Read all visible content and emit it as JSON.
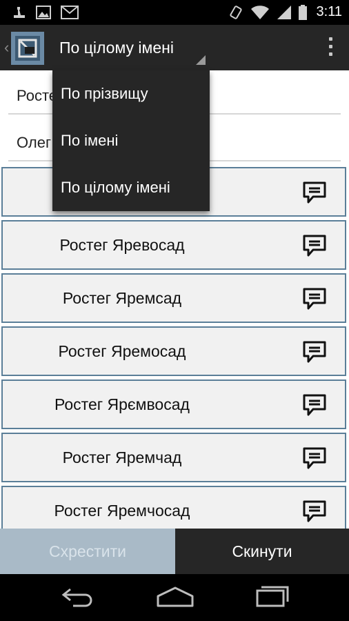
{
  "status_bar": {
    "time": "3:11",
    "left_icons": [
      "usb-debug-icon",
      "image-icon",
      "mail-icon"
    ],
    "right_icons": [
      "vibrate-icon",
      "wifi-icon",
      "signal-icon",
      "battery-icon"
    ]
  },
  "action_bar": {
    "title": "По цілому імені",
    "app_icon": "app-logo-icon",
    "overflow_icon": "overflow-menu-icon"
  },
  "fields": {
    "surname": {
      "value": "Ростег"
    },
    "name": {
      "value": "Олег"
    }
  },
  "dropdown": {
    "items": [
      {
        "label": "По прізвищу"
      },
      {
        "label": "По імені"
      },
      {
        "label": "По цілому імені"
      }
    ]
  },
  "results": [
    {
      "name": ""
    },
    {
      "name": "Ростег Яревосад"
    },
    {
      "name": "Ростег Яремсад"
    },
    {
      "name": "Ростег Яремосад"
    },
    {
      "name": "Ростег Ярємвосад"
    },
    {
      "name": "Ростег Яремчад"
    },
    {
      "name": "Ростег Яремчосад"
    }
  ],
  "buttons": {
    "cross": "Схрестити",
    "reset": "Скинути"
  },
  "colors": {
    "row_border": "#5a7e98",
    "row_bg": "#f1f1f1",
    "action_bar": "#262626",
    "cross_button_bg": "#a9bac7"
  },
  "nav_bar": [
    "back-icon",
    "home-icon",
    "recents-icon"
  ]
}
